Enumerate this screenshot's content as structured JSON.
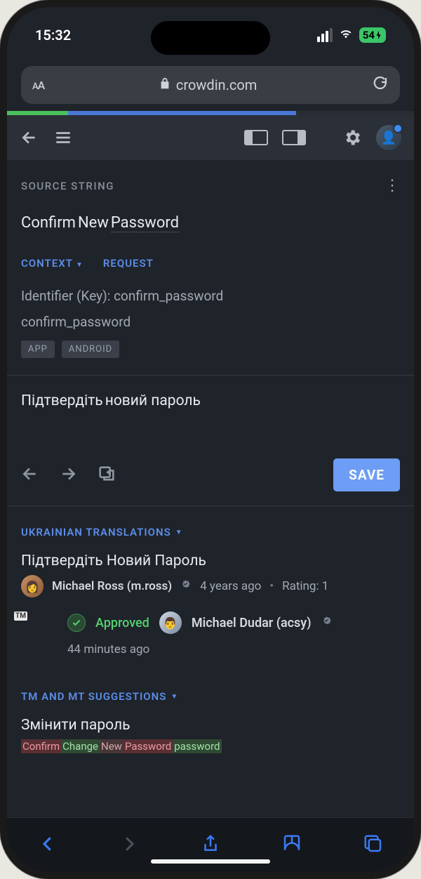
{
  "status_bar": {
    "time": "15:32",
    "battery": "54"
  },
  "browser": {
    "domain": "crowdin.com"
  },
  "progress": {
    "green_pct": 15,
    "blue_pct": 56
  },
  "section_label": "SOURCE STRING",
  "source_string": {
    "w1": "Confirm",
    "w2": "New",
    "w3": "Password"
  },
  "context": {
    "label": "CONTEXT",
    "request": "REQUEST",
    "identifier_label": "Identifier (Key): confirm_password",
    "identifier_value": "confirm_password",
    "tags": [
      "APP",
      "ANDROID"
    ]
  },
  "editor": {
    "w1": "Підтвердіть",
    "w2": "новий",
    "w3": "пароль",
    "save_label": "SAVE"
  },
  "translations": {
    "header": "UKRAINIAN TRANSLATIONS",
    "items": [
      {
        "text": "Підтвердіть Новий Пароль",
        "author": "Michael Ross (m.ross)",
        "time": "4 years ago",
        "rating": "Rating: 1",
        "tm_badge": "TM"
      }
    ],
    "approved": {
      "label": "Approved",
      "by": "Michael Dudar (acsy)",
      "time": "44 minutes ago"
    }
  },
  "suggestions": {
    "header": "TM AND MT SUGGESTIONS",
    "text": "Змінити пароль",
    "diff": {
      "del1": "Confirm",
      "add1": "Change",
      "keep1": " New ",
      "del2": "Password",
      "add2": "password"
    }
  }
}
